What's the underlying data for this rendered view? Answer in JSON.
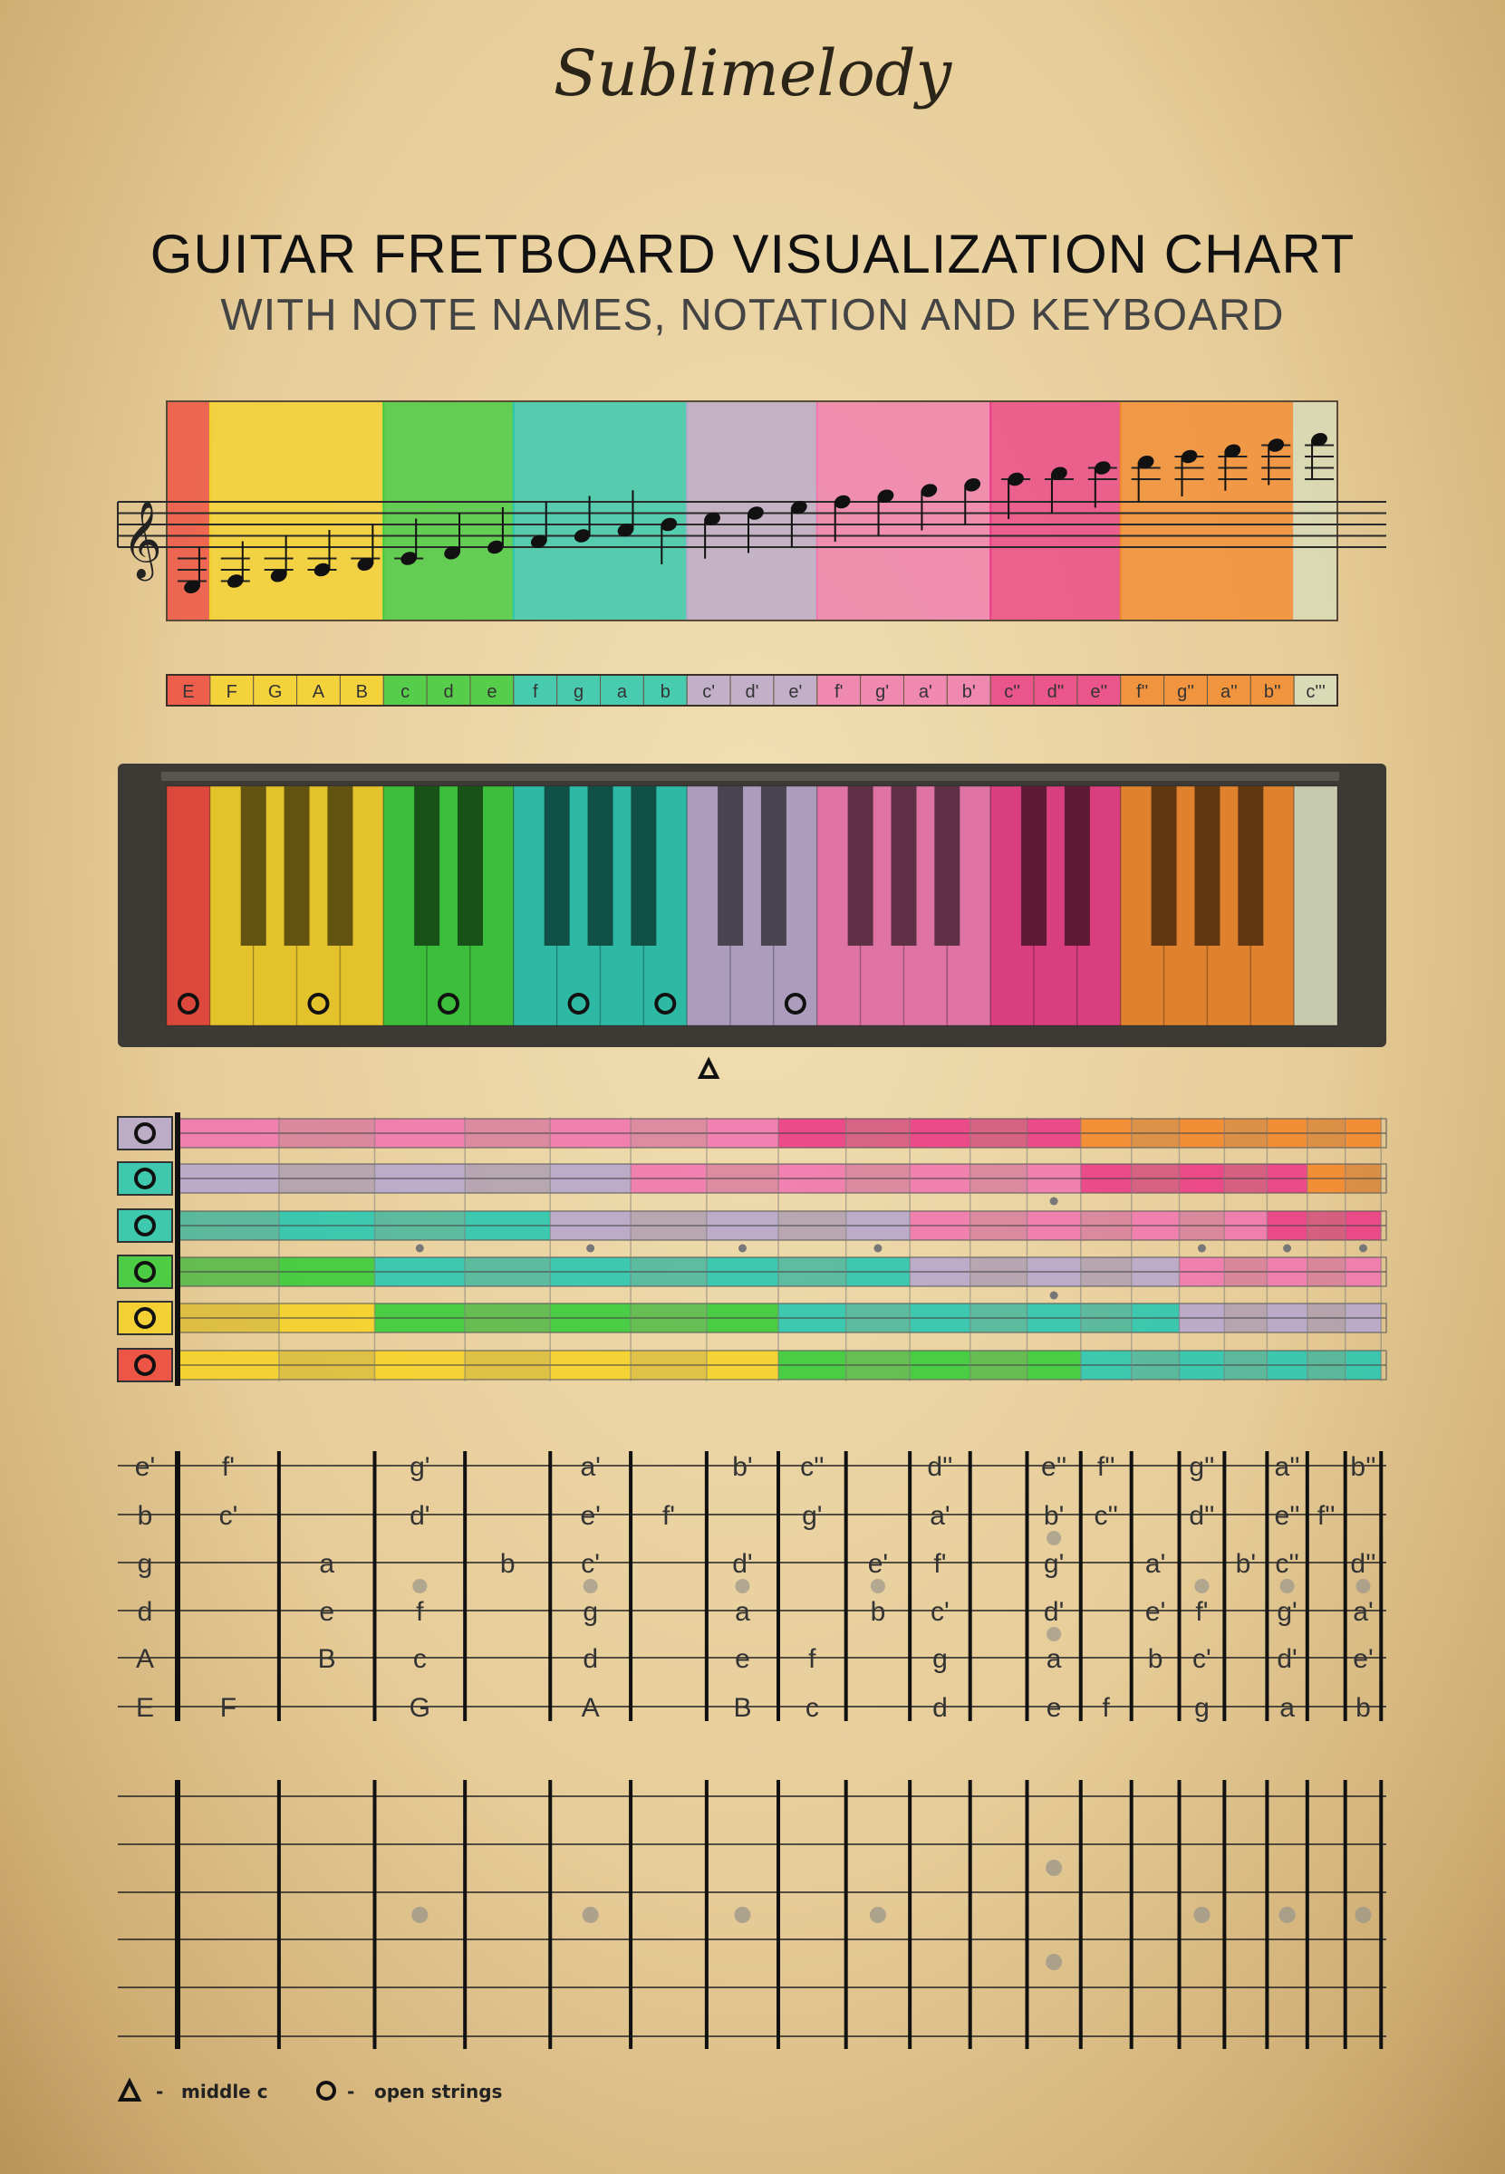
{
  "header": {
    "brand": "Sublimelody",
    "title": "GUITAR FRETBOARD VISUALIZATION CHART",
    "subtitle": "WITH NOTE NAMES, NOTATION AND KEYBOARD"
  },
  "octave_colors": {
    "red": "#ee4a3e",
    "yellow": "#f5d22a",
    "green": "#3ccc3c",
    "teal": "#2cc8b0",
    "lavender": "#b8a8cc",
    "pink": "#f07ab0",
    "magenta": "#ea3f86",
    "orange": "#f2892e",
    "pale": "#d6dcbb"
  },
  "notes": [
    {
      "name": "E",
      "group": "red"
    },
    {
      "name": "F",
      "group": "yellow"
    },
    {
      "name": "G",
      "group": "yellow"
    },
    {
      "name": "A",
      "group": "yellow"
    },
    {
      "name": "B",
      "group": "yellow"
    },
    {
      "name": "c",
      "group": "green"
    },
    {
      "name": "d",
      "group": "green"
    },
    {
      "name": "e",
      "group": "green"
    },
    {
      "name": "f",
      "group": "teal"
    },
    {
      "name": "g",
      "group": "teal"
    },
    {
      "name": "a",
      "group": "teal"
    },
    {
      "name": "b",
      "group": "teal"
    },
    {
      "name": "c'",
      "group": "lavender"
    },
    {
      "name": "d'",
      "group": "lavender"
    },
    {
      "name": "e'",
      "group": "lavender"
    },
    {
      "name": "f'",
      "group": "pink"
    },
    {
      "name": "g'",
      "group": "pink"
    },
    {
      "name": "a'",
      "group": "pink"
    },
    {
      "name": "b'",
      "group": "pink"
    },
    {
      "name": "c''",
      "group": "magenta"
    },
    {
      "name": "d''",
      "group": "magenta"
    },
    {
      "name": "e''",
      "group": "magenta"
    },
    {
      "name": "f''",
      "group": "orange"
    },
    {
      "name": "g''",
      "group": "orange"
    },
    {
      "name": "a''",
      "group": "orange"
    },
    {
      "name": "b''",
      "group": "orange"
    },
    {
      "name": "c'''",
      "group": "pale"
    }
  ],
  "open_string_notes": [
    "E",
    "A",
    "d",
    "g",
    "b",
    "e'"
  ],
  "middle_c_note": "c'",
  "strings": [
    {
      "open": "e'",
      "frets": [
        "f'",
        "",
        "g'",
        "",
        "a'",
        "",
        "b'",
        "c''",
        "",
        "d''",
        "",
        "e''",
        "f''",
        "",
        "g''",
        "",
        "a''",
        "",
        "b''"
      ]
    },
    {
      "open": "b",
      "frets": [
        "c'",
        "",
        "d'",
        "",
        "e'",
        "f'",
        "",
        "g'",
        "",
        "a'",
        "",
        "b'",
        "c''",
        "",
        "d''",
        "",
        "e''",
        "f''",
        ""
      ]
    },
    {
      "open": "g",
      "frets": [
        "",
        "a",
        "",
        "b",
        "c'",
        "",
        "d'",
        "",
        "e'",
        "f'",
        "",
        "g'",
        "",
        "a'",
        "",
        "b'",
        "c''",
        "",
        "d''"
      ]
    },
    {
      "open": "d",
      "frets": [
        "",
        "e",
        "f",
        "",
        "g",
        "",
        "a",
        "",
        "b",
        "c'",
        "",
        "d'",
        "",
        "e'",
        "f'",
        "",
        "g'",
        "",
        "a'"
      ]
    },
    {
      "open": "A",
      "frets": [
        "",
        "B",
        "c",
        "",
        "d",
        "",
        "e",
        "f",
        "",
        "g",
        "",
        "a",
        "",
        "b",
        "c'",
        "",
        "d'",
        "",
        "e'"
      ]
    },
    {
      "open": "E",
      "frets": [
        "F",
        "",
        "G",
        "",
        "A",
        "",
        "B",
        "c",
        "",
        "d",
        "",
        "e",
        "f",
        "",
        "g",
        "",
        "a",
        "",
        "b"
      ]
    }
  ],
  "fret_markers": {
    "single": [
      3,
      5,
      7,
      9,
      15,
      17,
      19
    ],
    "double": [
      12
    ]
  },
  "legend": {
    "middle_c": "middle c",
    "open_strings": "open strings"
  }
}
